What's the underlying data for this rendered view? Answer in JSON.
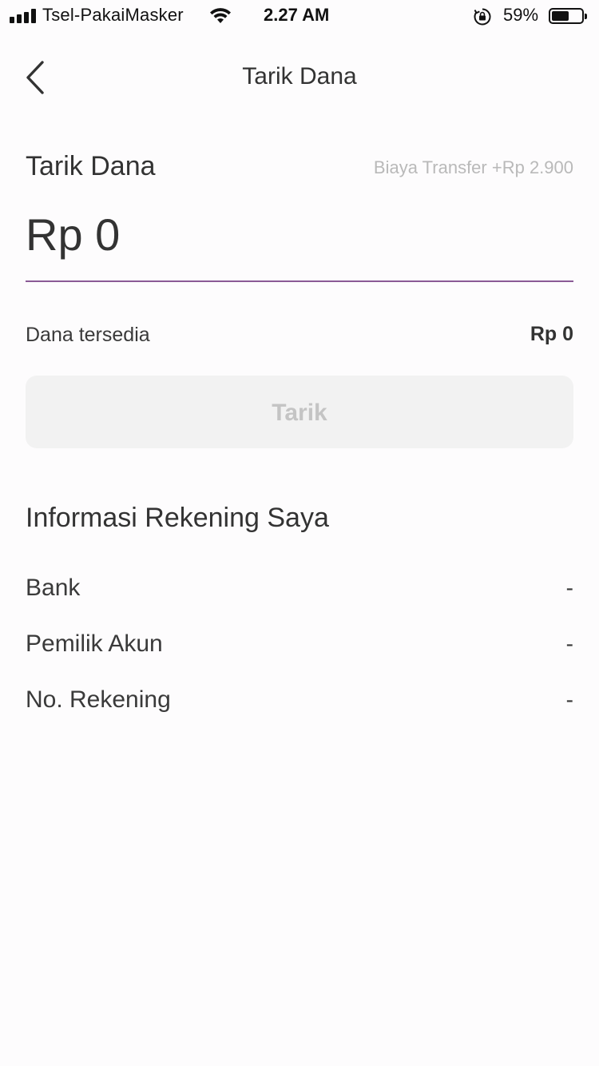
{
  "status_bar": {
    "carrier": "Tsel-PakaiMasker",
    "time": "2.27 AM",
    "battery_percent": "59%",
    "battery_level": 0.59,
    "signal_bars": 4
  },
  "header": {
    "title": "Tarik Dana",
    "back_icon": "chevron-left-icon"
  },
  "withdraw": {
    "title": "Tarik Dana",
    "fee": "Biaya Transfer +Rp 2.900",
    "amount_value": "Rp 0",
    "underline_color": "#8a5a96",
    "available_label": "Dana tersedia",
    "available_value": "Rp 0",
    "button_label": "Tarik"
  },
  "account_info": {
    "title": "Informasi Rekening Saya",
    "rows": [
      {
        "label": "Bank",
        "value": "-"
      },
      {
        "label": "Pemilik Akun",
        "value": "-"
      },
      {
        "label": "No. Rekening",
        "value": "-"
      }
    ]
  }
}
